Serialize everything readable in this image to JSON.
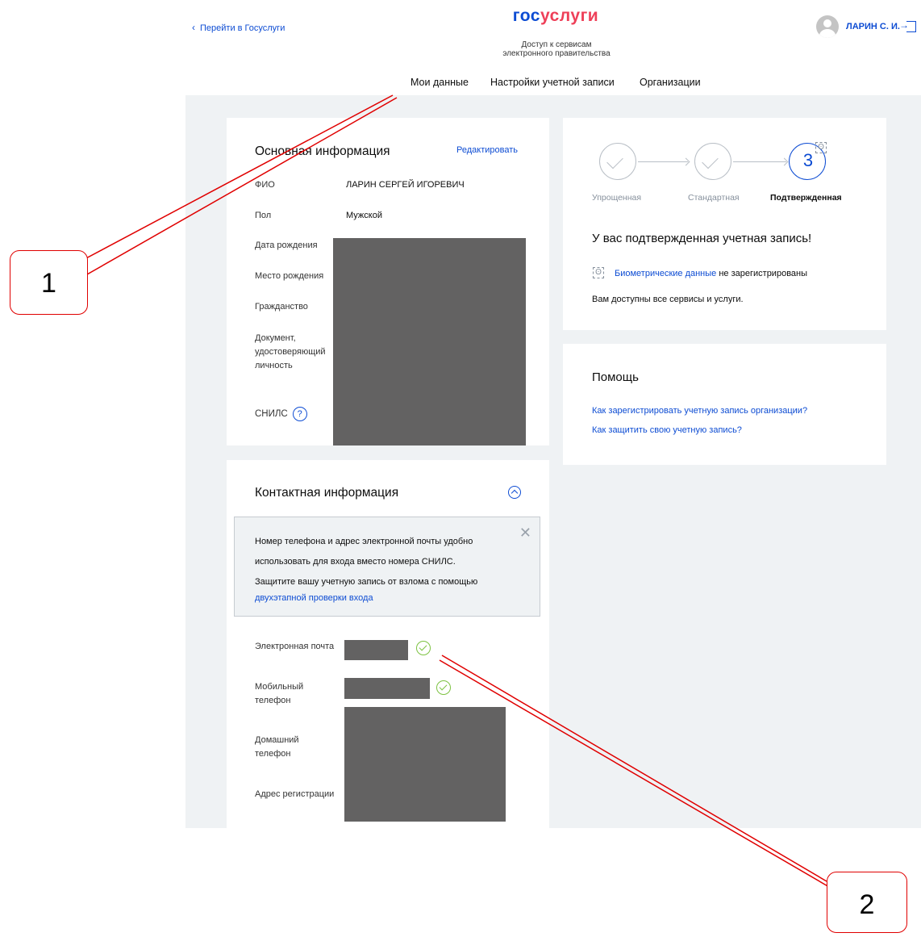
{
  "header": {
    "back_link": "Перейти в Госуслуги",
    "logo_part1": "гос",
    "logo_part2": "услуги",
    "tagline_line1": "Доступ к сервисам",
    "tagline_line2": "электронного правительства",
    "user_name": "ЛАРИН С. И."
  },
  "tabs": [
    {
      "label": "Мои данные",
      "active": true
    },
    {
      "label": "Настройки учетной записи",
      "active": false
    },
    {
      "label": "Организации",
      "active": false
    }
  ],
  "basic_info": {
    "title": "Основная информация",
    "edit_link": "Редактировать",
    "fields": [
      {
        "label": "ФИО",
        "value": "ЛАРИН СЕРГЕЙ ИГОРЕВИЧ"
      },
      {
        "label": "Пол",
        "value": "Мужской"
      },
      {
        "label": "Дата рождения",
        "value": ""
      },
      {
        "label": "Место рождения",
        "value": ""
      },
      {
        "label": "Гражданство",
        "value": ""
      },
      {
        "label": "Документ, удостоверяющий личность",
        "value": ""
      },
      {
        "label": "СНИЛС",
        "value": ""
      }
    ],
    "help_glyph": "?"
  },
  "account_status": {
    "steps": [
      {
        "label": "Упрощенная",
        "state": "done"
      },
      {
        "label": "Стандартная",
        "state": "done"
      },
      {
        "label": "Подтвержденная",
        "state": "current",
        "number": "3"
      }
    ],
    "headline": "У вас подтвержденная учетная запись!",
    "biometrics_link": "Биометрические данные",
    "biometrics_status": " не зарегистрированы",
    "services_text": "Вам доступны все сервисы и услуги."
  },
  "help": {
    "title": "Помощь",
    "links": [
      "Как зарегистрировать учетную запись организации?",
      "Как защитить свою учетную запись?"
    ]
  },
  "contact_info": {
    "title": "Контактная информация",
    "notice_lines": [
      "Номер телефона и адрес электронной почты удобно",
      "использовать для входа вместо номера СНИЛС.",
      "Защитите вашу учетную запись от взлома с помощью"
    ],
    "notice_link": "двухэтапной проверки входа",
    "fields": [
      {
        "label": "Электронная почта",
        "verified": true
      },
      {
        "label": "Мобильный телефон",
        "verified": true
      },
      {
        "label": "Домашний телефон",
        "verified": false
      },
      {
        "label": "Адрес регистрации",
        "verified": false
      }
    ]
  },
  "callouts": [
    "1",
    "2"
  ],
  "colors": {
    "accent": "#0d4cd3",
    "logo_red": "#ee3f58",
    "callout_red": "#e00000",
    "redaction": "#636262",
    "verified_green": "#7dc242",
    "backdrop": "#eff2f4"
  }
}
